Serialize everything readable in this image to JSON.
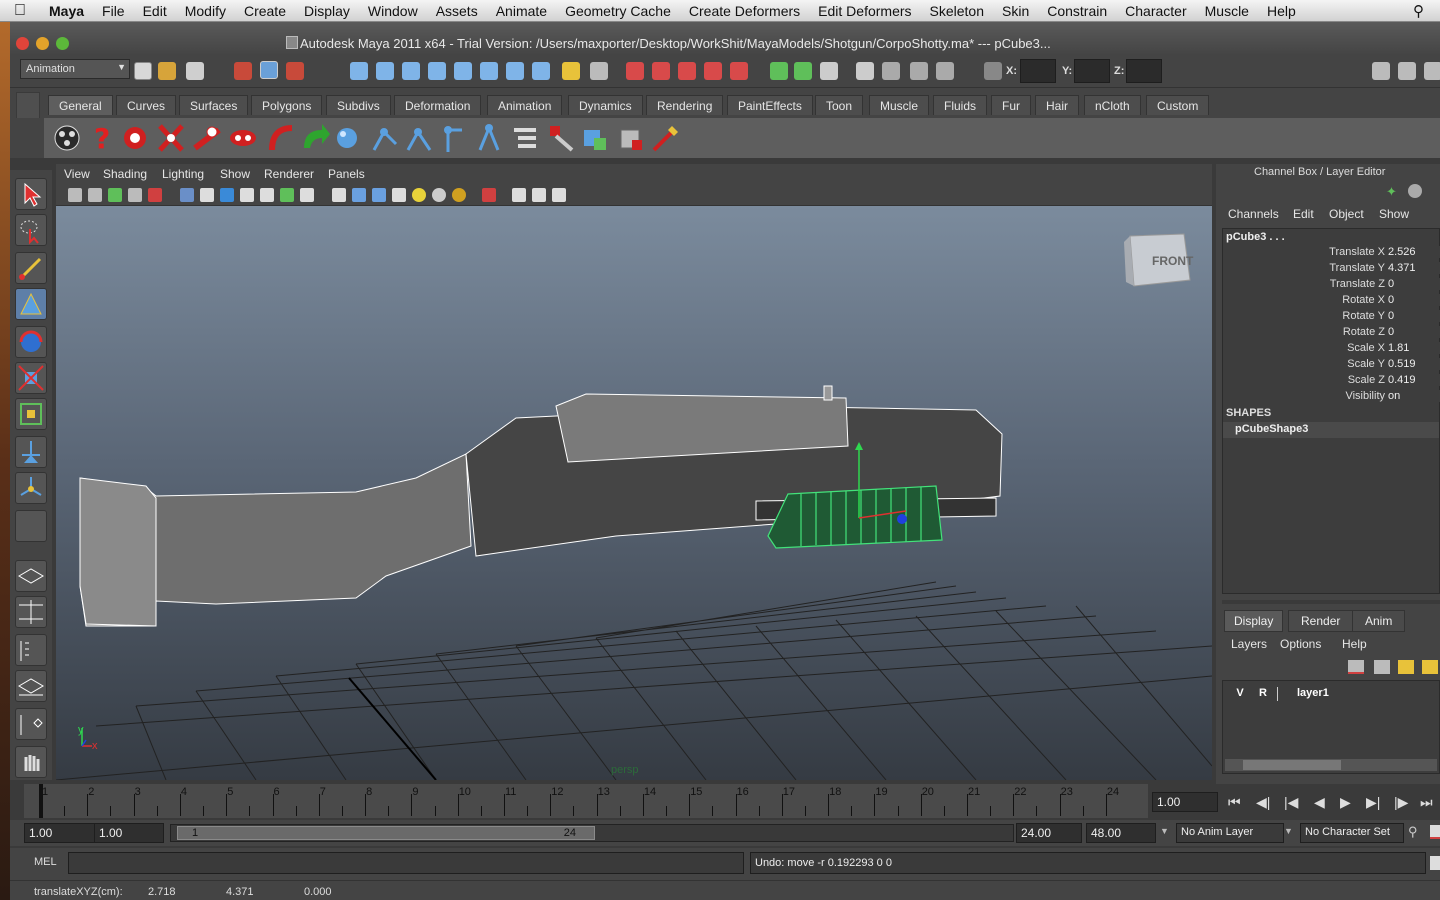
{
  "menubar": {
    "apple": "",
    "items": [
      "Maya",
      "File",
      "Edit",
      "Modify",
      "Create",
      "Display",
      "Window",
      "Assets",
      "Animate",
      "Geometry Cache",
      "Create Deformers",
      "Edit Deformers",
      "Skeleton",
      "Skin",
      "Constrain",
      "Character",
      "Muscle",
      "Help"
    ],
    "spotlight_icon": "search-icon"
  },
  "window": {
    "title": "Autodesk Maya 2011 x64 - Trial Version: /Users/maxporter/Desktop/WorkShit/MayaModels/Shotgun/CorpoShotty.ma*   ---   pCube3..."
  },
  "statusline": {
    "menuset": "Animation",
    "x_label": "X:",
    "y_label": "Y:",
    "z_label": "Z:"
  },
  "shelf": {
    "tabs": [
      "General",
      "Curves",
      "Surfaces",
      "Polygons",
      "Subdivs",
      "Deformation",
      "Animation",
      "Dynamics",
      "Rendering",
      "PaintEffects",
      "Toon",
      "Muscle",
      "Fluids",
      "Fur",
      "Hair",
      "nCloth",
      "Custom"
    ],
    "active_tab": "General"
  },
  "panel": {
    "menus": [
      "View",
      "Shading",
      "Lighting",
      "Show",
      "Renderer",
      "Panels"
    ],
    "viewcube_label": "FRONT",
    "camera_label": "persp",
    "axis_y": "y",
    "axis_x": "x"
  },
  "channelbox": {
    "header": "Channel Box / Layer Editor",
    "menus": [
      "Channels",
      "Edit",
      "Object",
      "Show"
    ],
    "object": "pCube3 . . .",
    "channels": [
      {
        "name": "Translate X",
        "value": "2.526"
      },
      {
        "name": "Translate Y",
        "value": "4.371"
      },
      {
        "name": "Translate Z",
        "value": "0"
      },
      {
        "name": "Rotate X",
        "value": "0"
      },
      {
        "name": "Rotate Y",
        "value": "0"
      },
      {
        "name": "Rotate Z",
        "value": "0"
      },
      {
        "name": "Scale X",
        "value": "1.81"
      },
      {
        "name": "Scale Y",
        "value": "0.519"
      },
      {
        "name": "Scale Z",
        "value": "0.419"
      },
      {
        "name": "Visibility",
        "value": "on"
      }
    ],
    "shapes_label": "SHAPES",
    "shape_name": "pCubeShape3"
  },
  "layereditor": {
    "tabs": [
      "Display",
      "Render",
      "Anim"
    ],
    "active_tab": "Display",
    "menus": [
      "Layers",
      "Options",
      "Help"
    ],
    "layer": {
      "v": "V",
      "r": "R",
      "name": "layer1"
    }
  },
  "timeslider": {
    "ticks": [
      "1",
      "2",
      "3",
      "4",
      "5",
      "6",
      "7",
      "8",
      "9",
      "10",
      "11",
      "12",
      "13",
      "14",
      "15",
      "16",
      "17",
      "18",
      "19",
      "20",
      "21",
      "22",
      "23",
      "24"
    ],
    "current_time": "1.00"
  },
  "range": {
    "start": "1.00",
    "playback_start": "1.00",
    "range_start_label": "1",
    "range_end_label": "24",
    "playback_end": "24.00",
    "end": "48.00",
    "anim_layer": "No Anim Layer",
    "character_set": "No Character Set"
  },
  "cmdline": {
    "label": "MEL",
    "result": "Undo: move -r 0.192293 0 0"
  },
  "helpline": {
    "label": "translateXYZ(cm):",
    "x": "2.718",
    "y": "4.371",
    "z": "0.000"
  },
  "colors": {
    "selection_green": "#43e27a",
    "wire_white": "#ffffff",
    "viewport_top": "#7b8b9d",
    "viewport_bottom": "#353b43"
  }
}
